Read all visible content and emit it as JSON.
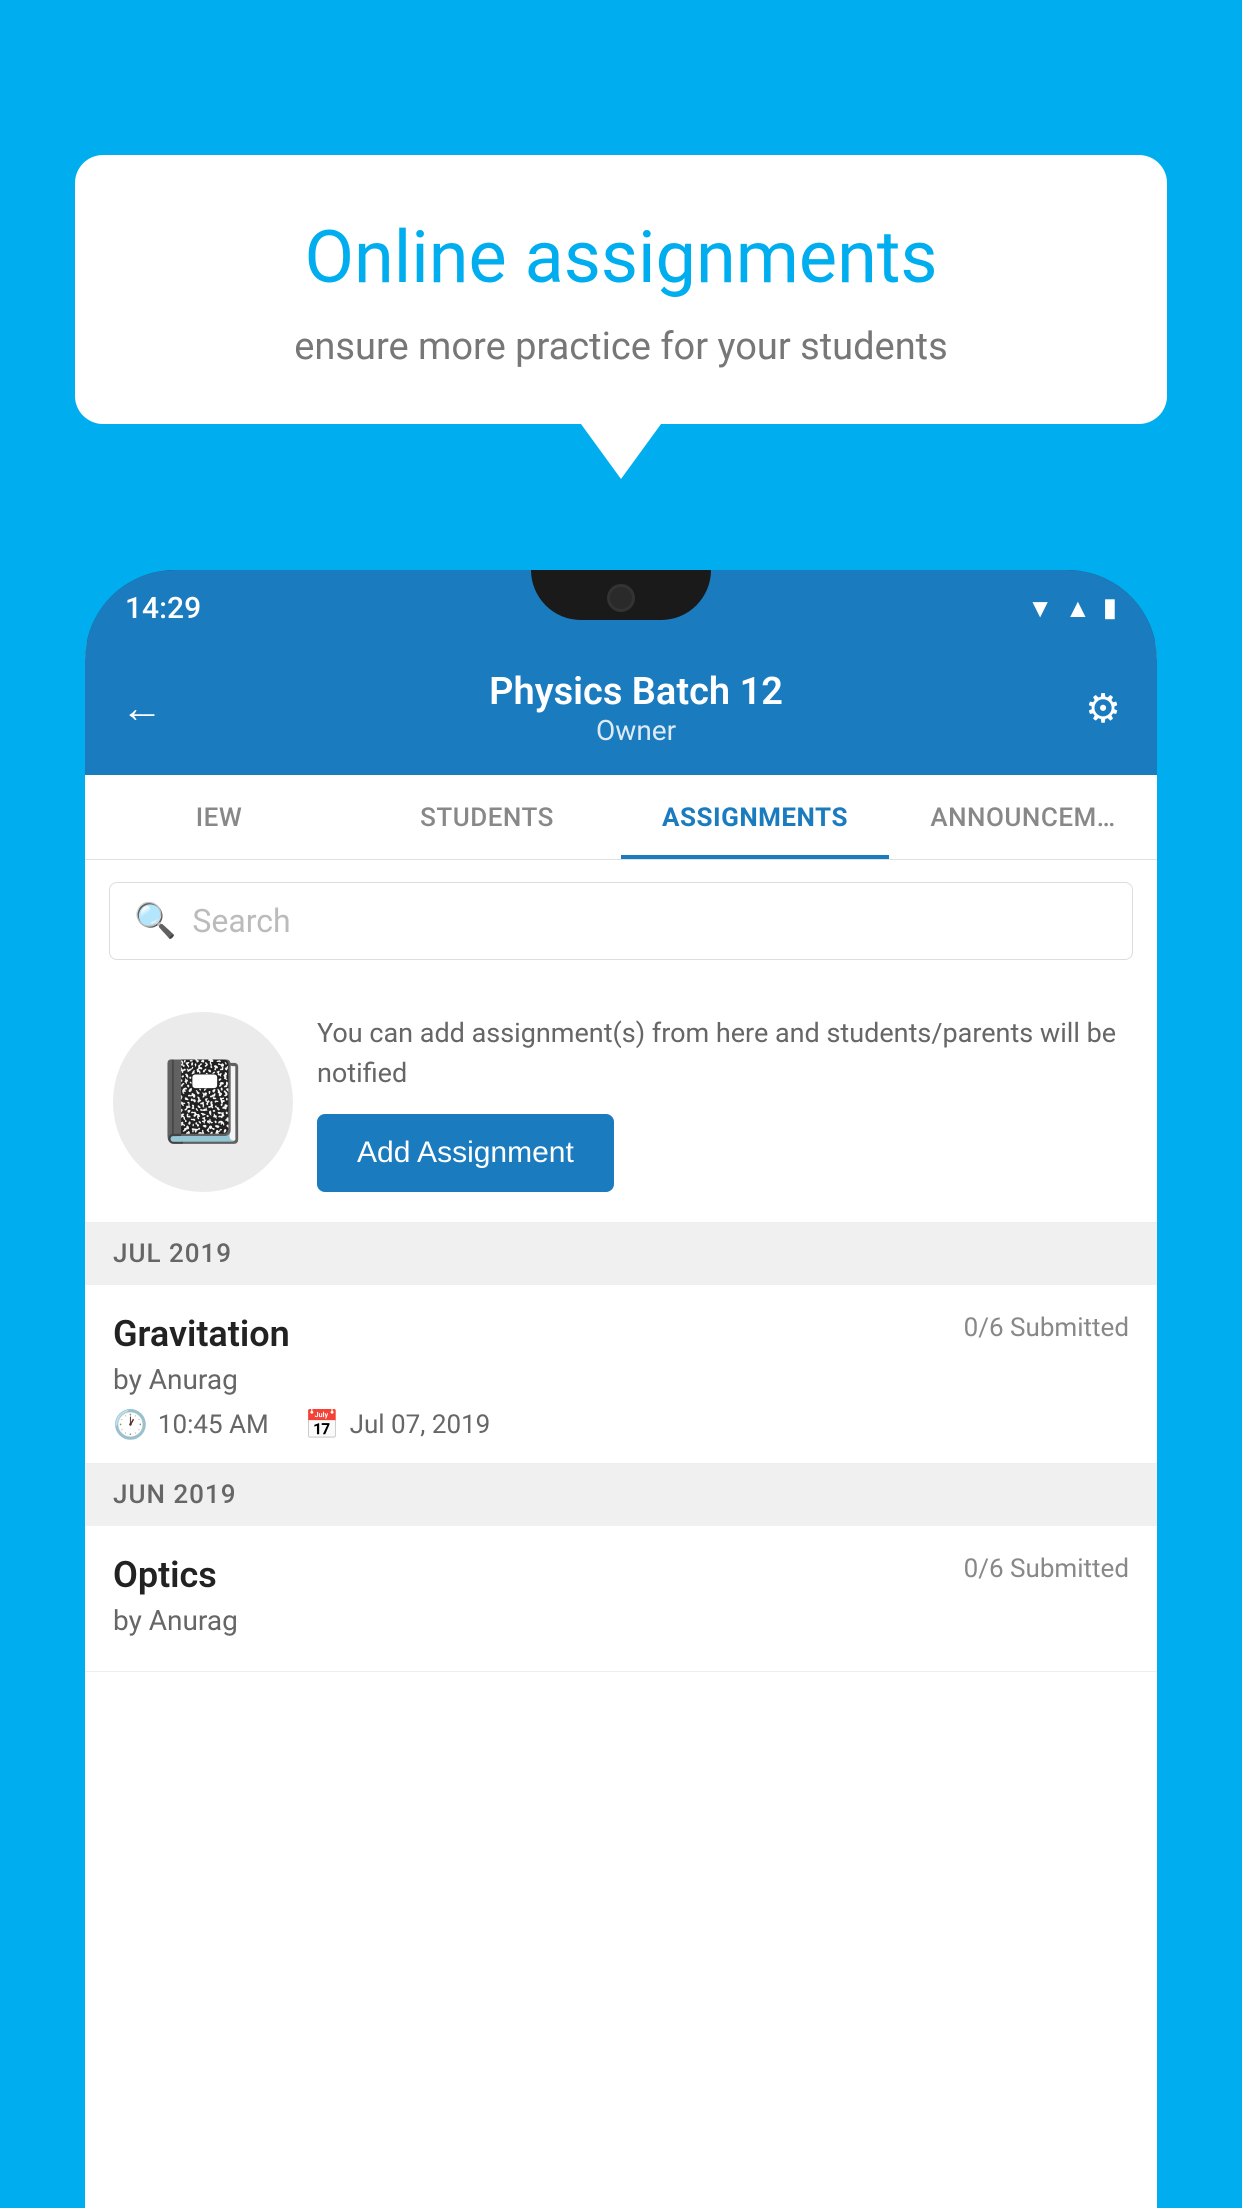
{
  "background_color": "#00AEEF",
  "speech_bubble": {
    "title": "Online assignments",
    "subtitle": "ensure more practice for your students"
  },
  "status_bar": {
    "time": "14:29",
    "wifi_icon": "▲",
    "signal_icon": "▲",
    "battery_icon": "▮"
  },
  "app_header": {
    "title": "Physics Batch 12",
    "subtitle": "Owner",
    "back_icon": "←",
    "settings_icon": "⚙"
  },
  "tabs": [
    {
      "label": "IEW",
      "active": false
    },
    {
      "label": "STUDENTS",
      "active": false
    },
    {
      "label": "ASSIGNMENTS",
      "active": true
    },
    {
      "label": "ANNOUNCEM…",
      "active": false
    }
  ],
  "search": {
    "placeholder": "Search"
  },
  "promo": {
    "description": "You can add assignment(s) from here and students/parents will be notified",
    "button_label": "Add Assignment"
  },
  "sections": [
    {
      "label": "JUL 2019",
      "assignments": [
        {
          "title": "Gravitation",
          "submitted": "0/6 Submitted",
          "by": "by Anurag",
          "time": "10:45 AM",
          "date": "Jul 07, 2019"
        }
      ]
    },
    {
      "label": "JUN 2019",
      "assignments": [
        {
          "title": "Optics",
          "submitted": "0/6 Submitted",
          "by": "by Anurag",
          "time": "",
          "date": ""
        }
      ]
    }
  ]
}
